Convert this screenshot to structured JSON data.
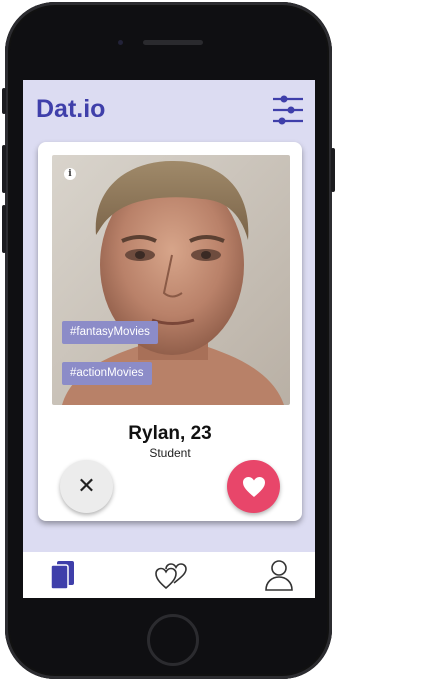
{
  "app": {
    "title": "Dat.io"
  },
  "icons": {
    "filter": "sliders-icon",
    "info": "info-icon",
    "dislike": "close-icon",
    "like": "heart-icon",
    "nav_cards": "cards-icon",
    "nav_matches": "hearts-icon",
    "nav_profile": "profile-icon"
  },
  "colors": {
    "accent": "#3f3faa",
    "background": "#dcdcf2",
    "like": "#e8466a",
    "tag": "#8c8cc8"
  },
  "profile": {
    "name_age": "Rylan, 23",
    "occupation": "Student",
    "tags": [
      "#fantasyMovies",
      "#actionMovies"
    ],
    "info_glyph": "i"
  },
  "actions": {
    "dislike_glyph": "✕"
  }
}
